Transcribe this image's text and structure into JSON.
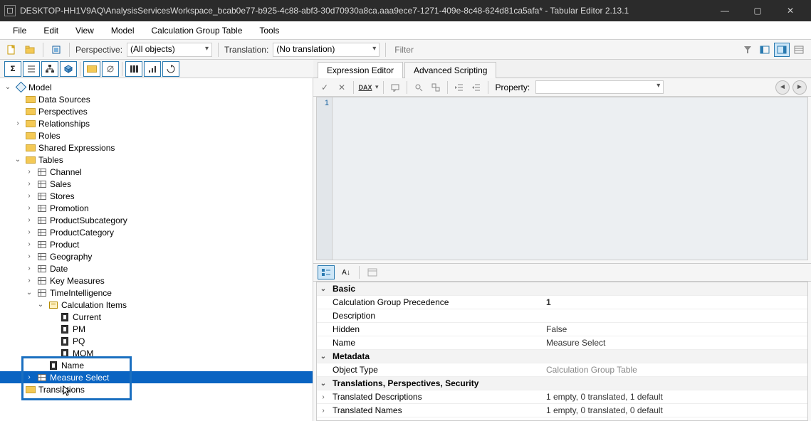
{
  "titlebar": {
    "title": "DESKTOP-HH1V9AQ\\AnalysisServicesWorkspace_bcab0e77-b925-4c88-abf3-30d70930a8ca.aaa9ece7-1271-409e-8c48-624d81ca5afa* - Tabular Editor 2.13.1"
  },
  "menubar": [
    "File",
    "Edit",
    "View",
    "Model",
    "Calculation Group Table",
    "Tools"
  ],
  "toolbar1": {
    "perspective_label": "Perspective:",
    "perspective_value": "(All objects)",
    "translation_label": "Translation:",
    "translation_value": "(No translation)",
    "filter_placeholder": "Filter"
  },
  "tree": {
    "root": "Model",
    "data_sources": "Data Sources",
    "perspectives": "Perspectives",
    "relationships": "Relationships",
    "roles": "Roles",
    "shared_expressions": "Shared Expressions",
    "tables_label": "Tables",
    "tables": [
      "Channel",
      "Sales",
      "Stores",
      "Promotion",
      "ProductSubcategory",
      "ProductCategory",
      "Product",
      "Geography",
      "Date",
      "Key Measures",
      "TimeIntelligence"
    ],
    "calc_items_label": "Calculation Items",
    "calc_items": [
      "Current",
      "PM",
      "PQ",
      "MOM"
    ],
    "name_col": "Name",
    "selected_node": "Measure Select",
    "translations": "Translations"
  },
  "tabs": {
    "expr": "Expression Editor",
    "script": "Advanced Scripting"
  },
  "editor": {
    "dax_label": "DAX",
    "property_label": "Property:",
    "line1": "1"
  },
  "propgrid": {
    "cat_basic": "Basic",
    "cgp_label": "Calculation Group Precedence",
    "cgp_value": "1",
    "desc_label": "Description",
    "desc_value": "",
    "hidden_label": "Hidden",
    "hidden_value": "False",
    "name_label": "Name",
    "name_value": "Measure Select",
    "cat_meta": "Metadata",
    "objtype_label": "Object Type",
    "objtype_value": "Calculation Group Table",
    "cat_tps": "Translations, Perspectives, Security",
    "tdesc_label": "Translated Descriptions",
    "tdesc_value": "1 empty, 0 translated, 1 default",
    "tnames_label": "Translated Names",
    "tnames_value": "1 empty, 0 translated, 0 default"
  }
}
